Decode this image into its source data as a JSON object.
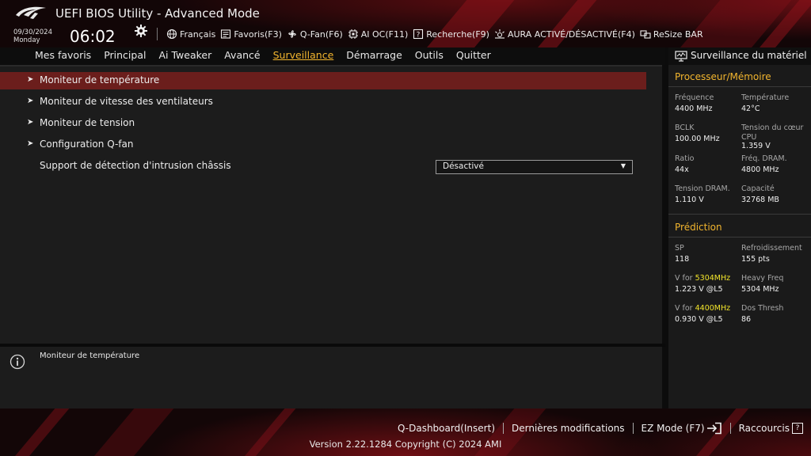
{
  "header": {
    "title": "UEFI BIOS Utility - Advanced Mode",
    "date": "09/30/2024",
    "day": "Monday",
    "time": "06:02",
    "toolbar": [
      {
        "label": "Français",
        "icon": "globe-icon"
      },
      {
        "label": "Favoris(F3)",
        "icon": "favorites-icon"
      },
      {
        "label": "Q-Fan(F6)",
        "icon": "fan-icon"
      },
      {
        "label": "AI OC(F11)",
        "icon": "ai-chip-icon"
      },
      {
        "label": "Recherche(F9)",
        "icon": "search-question-icon"
      },
      {
        "label": "AURA ACTIVÉ/DÉSACTIVÉ(F4)",
        "icon": "aura-icon"
      },
      {
        "label": "ReSize BAR",
        "icon": "resize-bar-icon"
      }
    ]
  },
  "nav": {
    "tabs": [
      "Mes favoris",
      "Principal",
      "Ai Tweaker",
      "Avancé",
      "Surveillance",
      "Démarrage",
      "Outils",
      "Quitter"
    ],
    "active": "Surveillance"
  },
  "main": {
    "items": [
      {
        "label": "Moniteur de température",
        "submenu": true,
        "selected": true
      },
      {
        "label": "Moniteur de vitesse des ventilateurs",
        "submenu": true
      },
      {
        "label": "Moniteur de tension",
        "submenu": true
      },
      {
        "label": "Configuration Q-fan",
        "submenu": true
      }
    ],
    "setting": {
      "label": "Support de détection d'intrusion châssis",
      "value": "Désactivé"
    }
  },
  "help": {
    "text": "Moniteur de température"
  },
  "monitor": {
    "title": "Surveillance du matériel",
    "cpu_section": "Processeur/Mémoire",
    "cpu": [
      {
        "k": "Fréquence",
        "v": "4400 MHz"
      },
      {
        "k": "Température",
        "v": "42°C"
      },
      {
        "k": "BCLK",
        "v": "100.00 MHz"
      },
      {
        "k": "Tension du cœur CPU",
        "v": "1.359 V"
      },
      {
        "k": "Ratio",
        "v": "44x"
      },
      {
        "k": "Fréq. DRAM.",
        "v": "4800 MHz"
      },
      {
        "k": "Tension DRAM.",
        "v": "1.110 V"
      },
      {
        "k": "Capacité",
        "v": "32768 MB"
      }
    ],
    "pred_section": "Prédiction",
    "pred": {
      "sp_k": "SP",
      "sp_v": "118",
      "cool_k": "Refroidissement",
      "cool_v": "155 pts",
      "v1_prefix": "V for ",
      "v1_freq": "5304MHz",
      "v1_v": "1.223 V @L5",
      "heavy_k": "Heavy Freq",
      "heavy_v": "5304 MHz",
      "v2_prefix": "V for ",
      "v2_freq": "4400MHz",
      "v2_v": "0.930 V @L5",
      "dos_k": "Dos Thresh",
      "dos_v": "86"
    }
  },
  "footer": {
    "links": [
      "Q-Dashboard(Insert)",
      "Dernières modifications",
      "EZ Mode (F7)",
      "Raccourcis"
    ],
    "version": "Version 2.22.1284 Copyright (C) 2024 AMI"
  },
  "colors": {
    "accent": "#f2b52e",
    "highlight": "#f2e42b",
    "selected_row": "#6b1e1c"
  }
}
